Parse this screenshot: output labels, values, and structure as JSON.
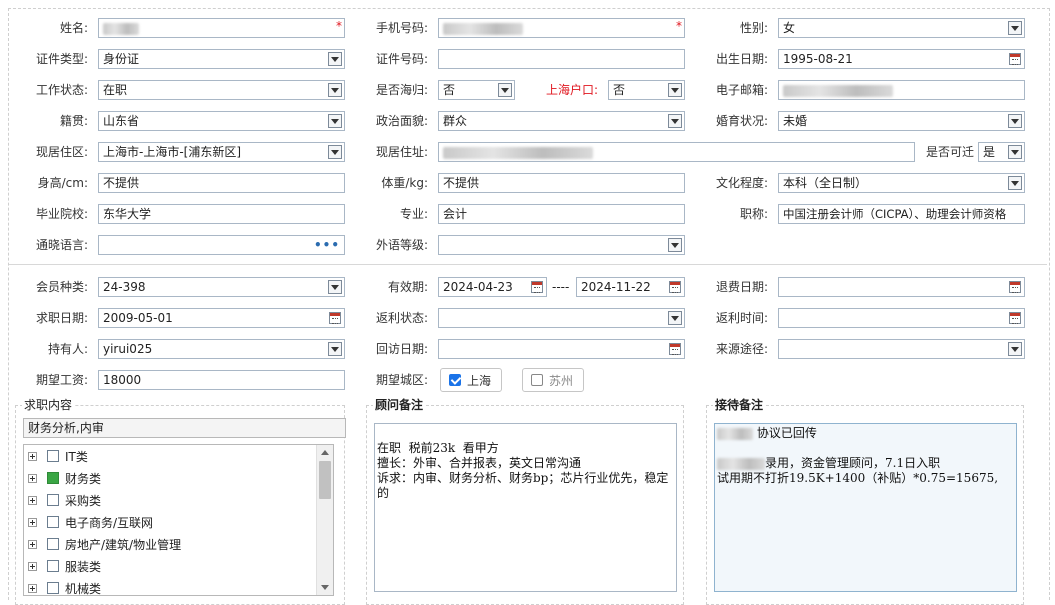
{
  "basic": {
    "name_label": "姓名:",
    "phone_label": "手机号码:",
    "gender_label": "性别:",
    "gender_value": "女",
    "id_type_label": "证件类型:",
    "id_type_value": "身份证",
    "id_no_label": "证件号码:",
    "birth_label": "出生日期:",
    "birth_value": "1995-08-21",
    "work_status_label": "工作状态:",
    "work_status_value": "在职",
    "overseas_label": "是否海归:",
    "overseas_value": "否",
    "hukou_label": "上海户口:",
    "hukou_value": "否",
    "email_label": "电子邮箱:",
    "native_label": "籍贯:",
    "native_value": "山东省",
    "political_label": "政治面貌:",
    "political_value": "群众",
    "marital_label": "婚育状况:",
    "marital_value": "未婚",
    "residence_area_label": "现居住区:",
    "residence_area_value": "上海市-上海市-[浦东新区]",
    "address_label": "现居住址:",
    "relocate_label": "是否可迁",
    "relocate_value": "是",
    "height_label": "身高/cm:",
    "height_value": "不提供",
    "weight_label": "体重/kg:",
    "weight_value": "不提供",
    "education_label": "文化程度:",
    "education_value": "本科（全日制）",
    "school_label": "毕业院校:",
    "school_value": "东华大学",
    "major_label": "专业:",
    "major_value": "会计",
    "title_label": "职称:",
    "title_value": "中国注册会计师（CICPA）、助理会计师资格",
    "language_label": "通晓语言:",
    "language_dots": "•••",
    "foreign_level_label": "外语等级:",
    "required_mark": "*"
  },
  "member": {
    "type_label": "会员种类:",
    "type_value": "24-398",
    "valid_label": "有效期:",
    "valid_from": "2024-04-23",
    "valid_sep": "----",
    "valid_to": "2024-11-22",
    "refund_date_label": "退费日期:",
    "job_date_label": "求职日期:",
    "job_date_value": "2009-05-01",
    "rebate_status_label": "返利状态:",
    "rebate_time_label": "返利时间:",
    "holder_label": "持有人:",
    "holder_value": "yirui025",
    "visit_date_label": "回访日期:",
    "source_label": "来源途径:",
    "salary_label": "期望工资:",
    "salary_value": "18000",
    "city_label": "期望城区:",
    "city_shanghai": "上海",
    "city_suzhou": "苏州"
  },
  "job_content": {
    "legend": "求职内容",
    "summary": "财务分析,内审",
    "items": [
      {
        "label": "IT类",
        "checked": false
      },
      {
        "label": "财务类",
        "checked": true
      },
      {
        "label": "采购类",
        "checked": false
      },
      {
        "label": "电子商务/互联网",
        "checked": false
      },
      {
        "label": "房地产/建筑/物业管理",
        "checked": false
      },
      {
        "label": "服装类",
        "checked": false
      },
      {
        "label": "机械类",
        "checked": false
      }
    ]
  },
  "advisor_notes": {
    "legend": "顾问备注",
    "text": "\n在职  税前23k  看甲方\n擅长：外审、合并报表，英文日常沟通\n诉求：内审、财务分析、财务bp；芯片行业优先，稳定的"
  },
  "reception_notes": {
    "legend": "接待备注",
    "line1": " 协议已回传",
    "line2": "录用，资金管理顾问，7.1日入职",
    "line3": "试用期不打折19.5K+1400（补贴）*0.75=15675,"
  }
}
